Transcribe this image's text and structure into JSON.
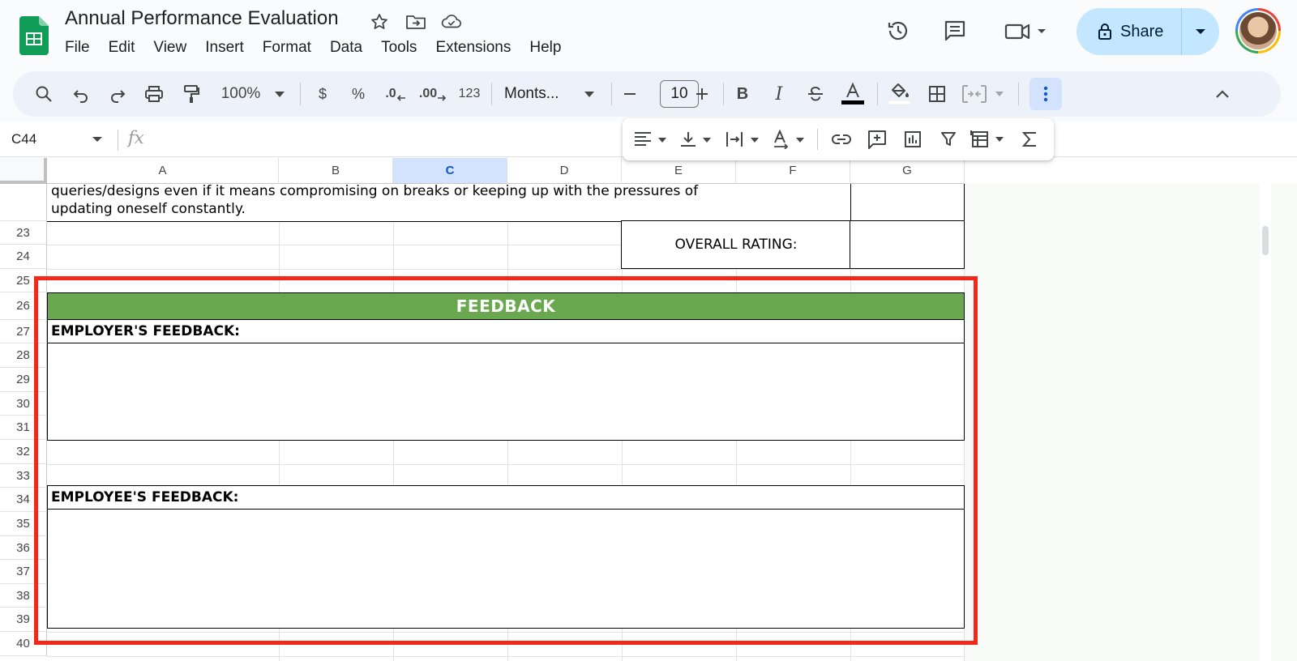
{
  "doc": {
    "title": "Annual Performance Evaluation"
  },
  "menu": [
    "File",
    "Edit",
    "View",
    "Insert",
    "Format",
    "Data",
    "Tools",
    "Extensions",
    "Help"
  ],
  "header": {
    "share_label": "Share"
  },
  "toolbar": {
    "zoom": "100%",
    "currency_label": "$",
    "percent_label": "%",
    "decrease_decimal_label": ".0",
    "increase_decimal_label": ".00",
    "number_format_label": "123",
    "font_family": "Monts...",
    "font_size": "10",
    "bold_label": "B",
    "italic_label": "I"
  },
  "formula_bar": {
    "name_box": "C44",
    "fx_label": "fx"
  },
  "grid": {
    "columns": [
      "A",
      "B",
      "C",
      "D",
      "E",
      "F",
      "G"
    ],
    "selected_column": "C",
    "rows": [
      "23",
      "24",
      "25",
      "26",
      "27",
      "28",
      "29",
      "30",
      "31",
      "32",
      "33",
      "34",
      "35",
      "36",
      "37",
      "38",
      "39",
      "40"
    ],
    "top_text_line1": "queries/designs even if it means compromising on breaks or keeping up with the pressures of",
    "top_text_line2": "updating oneself constantly.",
    "overall_rating_label": "OVERALL RATING:",
    "feedback_title": "FEEDBACK",
    "employer_feedback_label": "EMPLOYER'S FEEDBACK:",
    "employee_feedback_label": "EMPLOYEE'S FEEDBACK:"
  },
  "colors": {
    "feedback_banner": "#6aa84f",
    "highlight_frame": "#f4271a",
    "share_button": "#c2e7ff",
    "selected_column": "#d3e3fd"
  }
}
